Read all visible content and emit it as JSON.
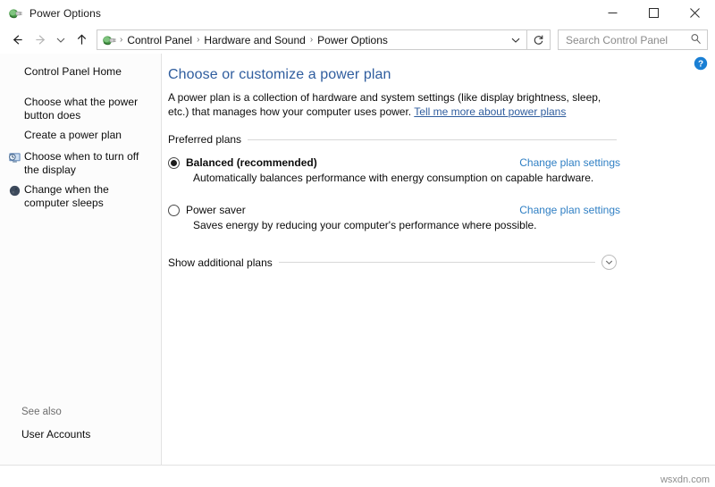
{
  "window": {
    "title": "Power Options",
    "app_icon": "power-plug-icon",
    "controls": {
      "minimize": "minimize-icon",
      "maximize": "maximize-icon",
      "close": "close-icon"
    }
  },
  "navbar": {
    "back": "back-arrow-icon",
    "forward": "forward-arrow-icon",
    "recent": "recent-locations-chevron-icon",
    "up": "up-arrow-icon",
    "breadcrumb_icon": "power-plug-icon",
    "breadcrumb": [
      "Control Panel",
      "Hardware and Sound",
      "Power Options"
    ],
    "separator": "›",
    "dropdown": "chevron-down-icon",
    "refresh": "refresh-icon",
    "search": {
      "placeholder": "Search Control Panel",
      "icon": "search-icon",
      "value": ""
    }
  },
  "sidebar": {
    "home": "Control Panel Home",
    "items": [
      {
        "label": "Choose what the power button does",
        "icon": ""
      },
      {
        "label": "Create a power plan",
        "icon": ""
      },
      {
        "label": "Choose when to turn off the display",
        "icon": "display-clock-icon"
      },
      {
        "label": "Change when the computer sleeps",
        "icon": "sleep-moon-icon"
      }
    ],
    "see_also": {
      "title": "See also",
      "links": [
        "User Accounts"
      ]
    }
  },
  "main": {
    "help_button": "help-icon",
    "title": "Choose or customize a power plan",
    "intro_text": "A power plan is a collection of hardware and system settings (like display brightness, sleep, etc.) that manages how your computer uses power. ",
    "intro_link": "Tell me more about power plans",
    "preferred_plans_label": "Preferred plans",
    "plans": [
      {
        "name": "Balanced (recommended)",
        "description": "Automatically balances performance with energy consumption on capable hardware.",
        "selected": true,
        "link": "Change plan settings"
      },
      {
        "name": "Power saver",
        "description": "Saves energy by reducing your computer's performance where possible.",
        "selected": false,
        "link": "Change plan settings"
      }
    ],
    "show_additional_label": "Show additional plans",
    "expander_icon": "chevron-down-icon"
  },
  "footer": {
    "watermark": "wsxdn.com"
  },
  "colors": {
    "title_blue": "#2f5d9e",
    "link_blue": "#2f7fc4",
    "help_blue": "#1a7fd4",
    "plug_green": "#3f8b3f"
  }
}
